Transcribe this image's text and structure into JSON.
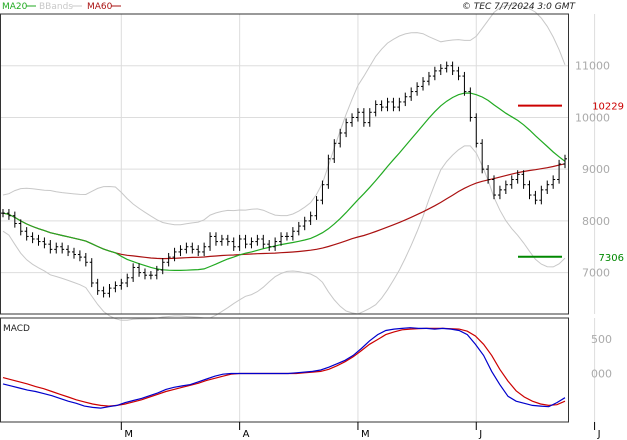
{
  "header": {
    "legend_items": [
      {
        "label": "MA20",
        "color": "#22aa22"
      },
      {
        "label": "BBands",
        "color": "#c8c8c8"
      },
      {
        "label": "MA60",
        "color": "#aa1111"
      }
    ],
    "copyright": "© TEC 7/7/2024 3:0 GMT"
  },
  "macd_panel": {
    "title": "MACD"
  },
  "chart_data": [
    {
      "type": "ohlc",
      "x": {
        "month_labels": [
          "M",
          "A",
          "M",
          "J",
          "J"
        ],
        "month_label_bars": [
          20,
          40,
          60,
          80,
          100
        ]
      },
      "y_axis": {
        "ticks": [
          7000,
          8000,
          9000,
          10000,
          11000
        ],
        "tick_labels": [
          "7000",
          "8000",
          "9000",
          "10000",
          "11000"
        ],
        "ylim": [
          6200,
          12000
        ]
      },
      "markers": [
        {
          "label": "10229",
          "value": 10229,
          "color": "#cc0000"
        },
        {
          "label": "7306",
          "value": 7306,
          "color": "#008800"
        }
      ],
      "series": [
        {
          "name": "MA20",
          "color": "#22aa22"
        },
        {
          "name": "BBands",
          "color": "#c8c8c8"
        },
        {
          "name": "MA60",
          "color": "#aa1111"
        }
      ],
      "close": [
        8150,
        8100,
        7950,
        7800,
        7700,
        7650,
        7600,
        7550,
        7450,
        7500,
        7450,
        7400,
        7350,
        7300,
        7200,
        6800,
        6650,
        6600,
        6700,
        6750,
        6800,
        6900,
        7100,
        7000,
        6950,
        6950,
        7050,
        7200,
        7300,
        7400,
        7450,
        7500,
        7450,
        7400,
        7500,
        7700,
        7600,
        7650,
        7600,
        7500,
        7650,
        7550,
        7600,
        7650,
        7550,
        7500,
        7600,
        7700,
        7700,
        7800,
        7900,
        8000,
        8100,
        8400,
        8700,
        9200,
        9500,
        9700,
        9900,
        10000,
        10100,
        9900,
        10100,
        10250,
        10200,
        10300,
        10200,
        10300,
        10400,
        10500,
        10600,
        10700,
        10800,
        10900,
        10950,
        11000,
        10900,
        10800,
        10500,
        10000,
        9500,
        9000,
        8800,
        8500,
        8600,
        8700,
        8800,
        8900,
        8700,
        8500,
        8400,
        8600,
        8700,
        8800,
        9100,
        9200
      ],
      "macd_panel": {
        "ticks": [
          500,
          0
        ],
        "tick_labels": [
          "500",
          "000"
        ],
        "macd": [
          -150,
          -180,
          -210,
          -240,
          -260,
          -290,
          -320,
          -360,
          -400,
          -430,
          -470,
          -490,
          -500,
          -480,
          -460,
          -420,
          -390,
          -360,
          -320,
          -280,
          -230,
          -200,
          -180,
          -160,
          -120,
          -80,
          -40,
          -10,
          0,
          0,
          0,
          0,
          0,
          0,
          0,
          0,
          10,
          20,
          30,
          50,
          90,
          140,
          190,
          260,
          360,
          470,
          560,
          620,
          640,
          650,
          660,
          650,
          650,
          640,
          650,
          640,
          620,
          560,
          420,
          260,
          30,
          -160,
          -330,
          -400,
          -430,
          -460,
          -470,
          -480,
          -420,
          -350
        ],
        "signal": [
          -60,
          -90,
          -120,
          -150,
          -190,
          -220,
          -260,
          -300,
          -340,
          -380,
          -410,
          -440,
          -460,
          -470,
          -460,
          -440,
          -410,
          -380,
          -340,
          -300,
          -260,
          -230,
          -200,
          -170,
          -140,
          -100,
          -70,
          -40,
          -10,
          0,
          0,
          0,
          0,
          0,
          0,
          0,
          0,
          10,
          20,
          30,
          60,
          110,
          170,
          240,
          330,
          420,
          490,
          560,
          600,
          630,
          640,
          645,
          650,
          650,
          650,
          645,
          640,
          610,
          540,
          420,
          260,
          60,
          -110,
          -250,
          -340,
          -400,
          -440,
          -460,
          -450,
          -400
        ]
      }
    }
  ]
}
